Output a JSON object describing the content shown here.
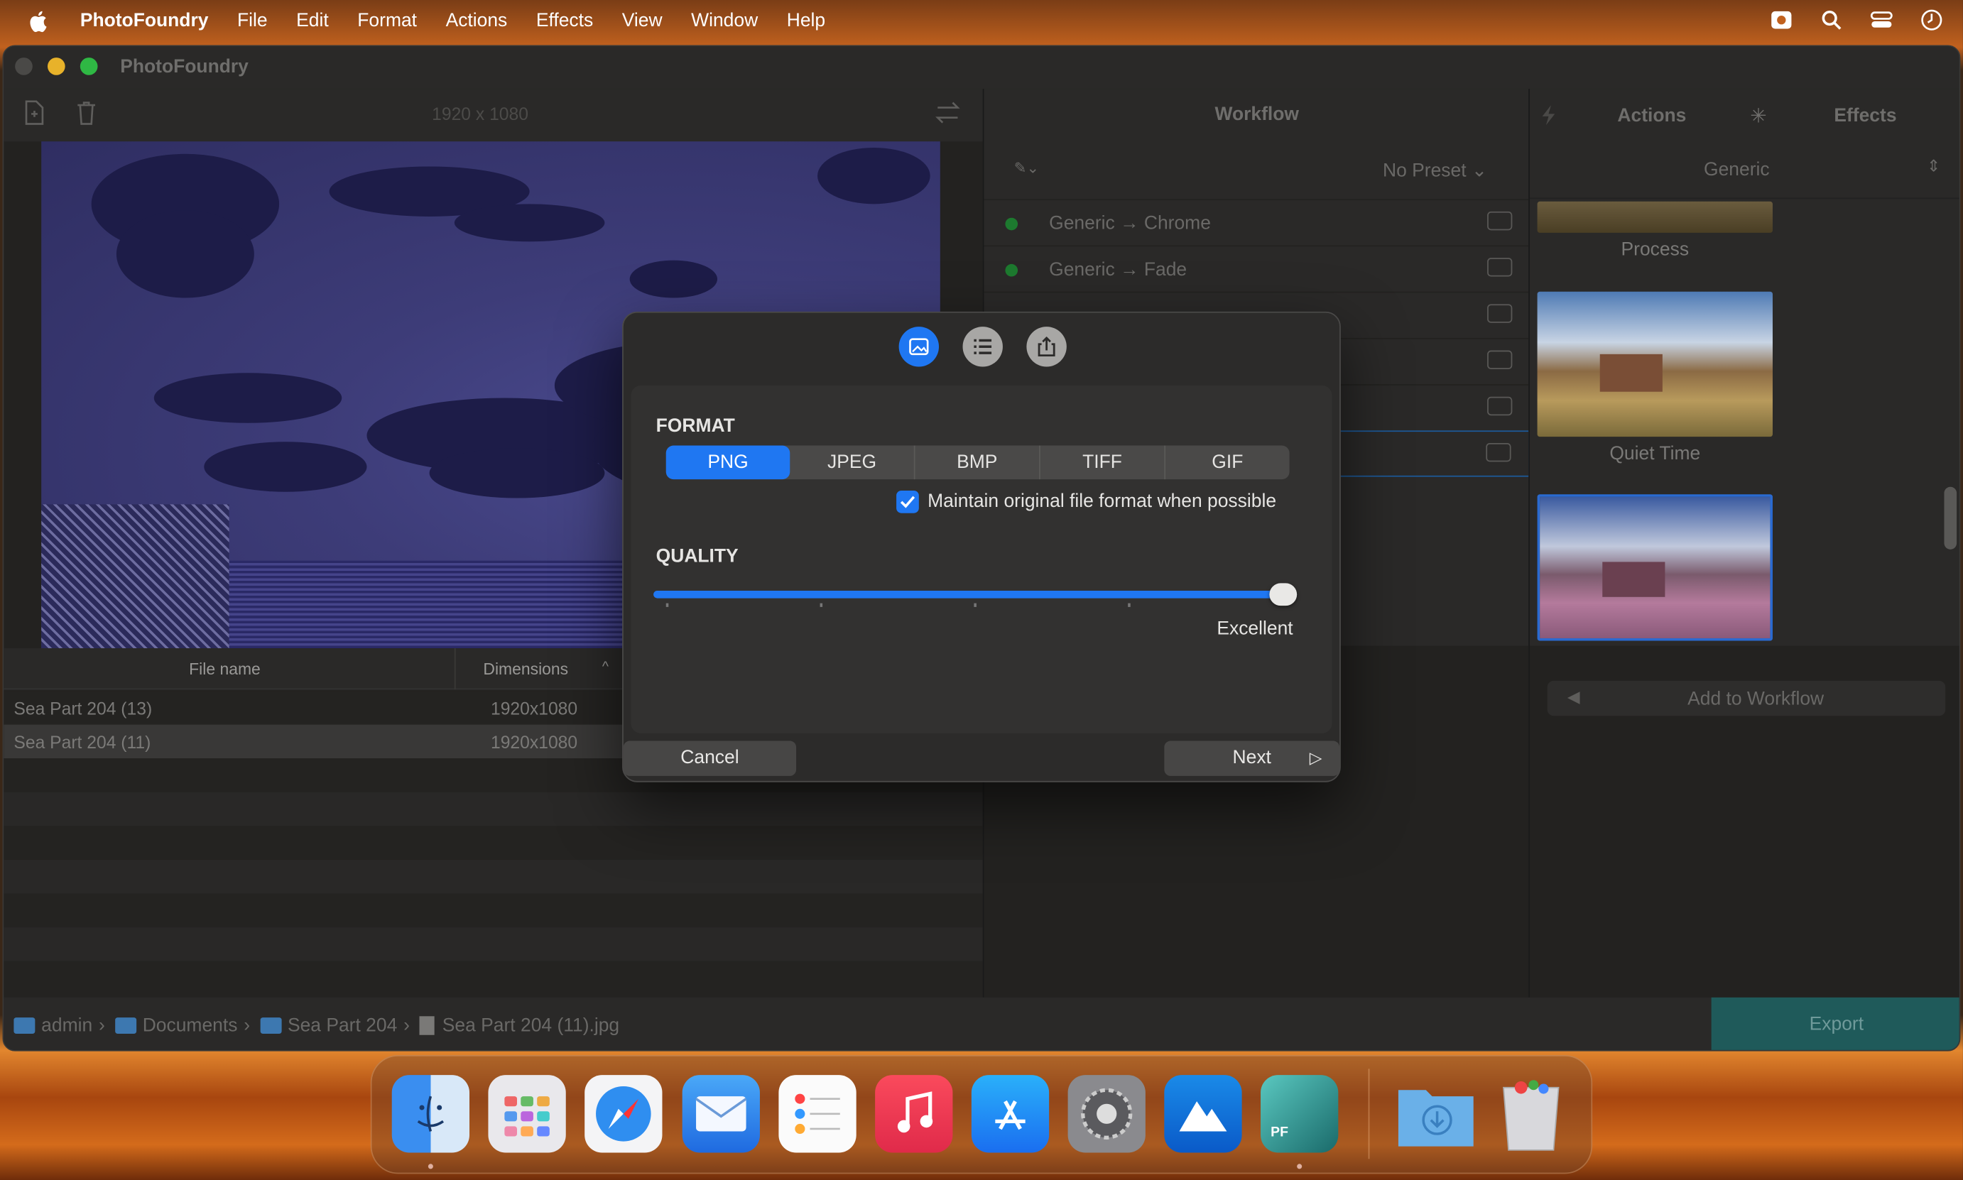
{
  "menubar": {
    "app_name": "PhotoFoundry",
    "items": [
      "File",
      "Edit",
      "Format",
      "Actions",
      "Effects",
      "View",
      "Window",
      "Help"
    ]
  },
  "window": {
    "title": "PhotoFoundry",
    "image_dimensions": "1920 x 1080"
  },
  "table": {
    "col_filename": "File name",
    "col_dimensions": "Dimensions",
    "rows": [
      {
        "name": "Sea Part 204 (13)",
        "dims": "1920x1080"
      },
      {
        "name": "Sea Part 204 (11)",
        "dims": "1920x1080"
      }
    ]
  },
  "workflow": {
    "title": "Workflow",
    "preset": "No Preset",
    "items": [
      {
        "label": "Generic → Chrome"
      },
      {
        "label": "Generic → Fade"
      }
    ]
  },
  "effects": {
    "tab_actions": "Actions",
    "tab_effects": "Effects",
    "category": "Generic",
    "thumbs": [
      "Process",
      "Quiet Time"
    ],
    "add_button": "Add to Workflow"
  },
  "dialog": {
    "format_label": "FORMAT",
    "formats": [
      "PNG",
      "JPEG",
      "BMP",
      "TIFF",
      "GIF"
    ],
    "selected_format": "PNG",
    "maintain_label": "Maintain original file format when possible",
    "maintain_checked": true,
    "quality_label": "QUALITY",
    "quality_value": 1.0,
    "quality_text": "Excellent",
    "cancel": "Cancel",
    "next": "Next"
  },
  "pathbar": {
    "segments": [
      "admin",
      "Documents",
      "Sea Part 204",
      "Sea Part 204 (11).jpg"
    ]
  },
  "export_button": "Export",
  "dock": {
    "apps": [
      "finder-icon",
      "launchpad-icon",
      "safari-icon",
      "mail-icon",
      "reminders-icon",
      "music-icon",
      "app-store-icon",
      "system-settings-icon",
      "mountain-app-icon",
      "photofoundry-icon",
      "downloads-folder-icon",
      "trash-icon"
    ],
    "pf_label": "PF"
  },
  "colors": {
    "accent": "#1f77f2",
    "export_bg": "#1f5a5a",
    "status_green": "#1d7a2f"
  }
}
